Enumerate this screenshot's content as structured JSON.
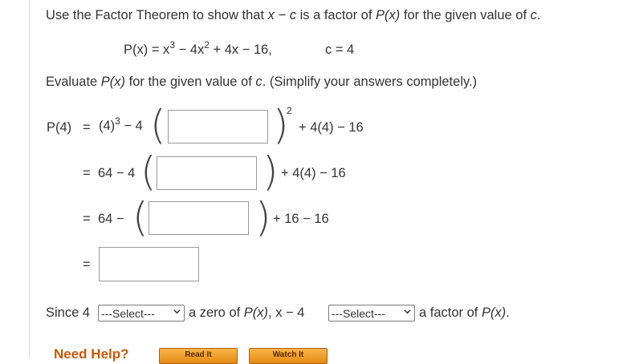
{
  "instruction": {
    "prefix": "Use the Factor Theorem to show that ",
    "math": "x − c",
    "middle": " is a factor of ",
    "poly": "P(x)",
    "suffix": " for the given value of ",
    "c": "c",
    "end": "."
  },
  "given": {
    "lhs": "P(x) = x",
    "exp3": "3",
    "mid1": " − 4x",
    "exp2": "2",
    "rest": " + 4x − 16,",
    "cval": "c = 4"
  },
  "evaluate": {
    "prefix": "Evaluate ",
    "poly": "P(x)",
    "middle": " for the given value of ",
    "c": "c",
    "suffix": ". (Simplify your answers completely.)"
  },
  "steps": {
    "row1": {
      "lhs": "P(4)",
      "eq": "=",
      "term": "(4)",
      "exp": "3",
      "minus": " − 4",
      "outer_exp": "2",
      "tail": "+ 4(4) − 16"
    },
    "row2": {
      "eq": "=",
      "term": "64 − 4",
      "tail": "+ 4(4) − 16"
    },
    "row3": {
      "eq": "=",
      "term": "64 −",
      "tail": "+ 16 − 16"
    },
    "row4": {
      "eq": "="
    }
  },
  "conclusion": {
    "since": "Since 4",
    "select1": "---Select---",
    "zero_of": "a zero of ",
    "poly": "P(x)",
    "comma": ", x − 4",
    "select2": "---Select---",
    "factor_of": "a factor of ",
    "poly2": "P(x)",
    "end": "."
  },
  "footer": {
    "need_help": "Need Help?",
    "read_it": "Read It",
    "watch_it": "Watch It"
  },
  "colors": {
    "text": "#333333",
    "help": "#c8590a",
    "button": "#f0a030"
  }
}
